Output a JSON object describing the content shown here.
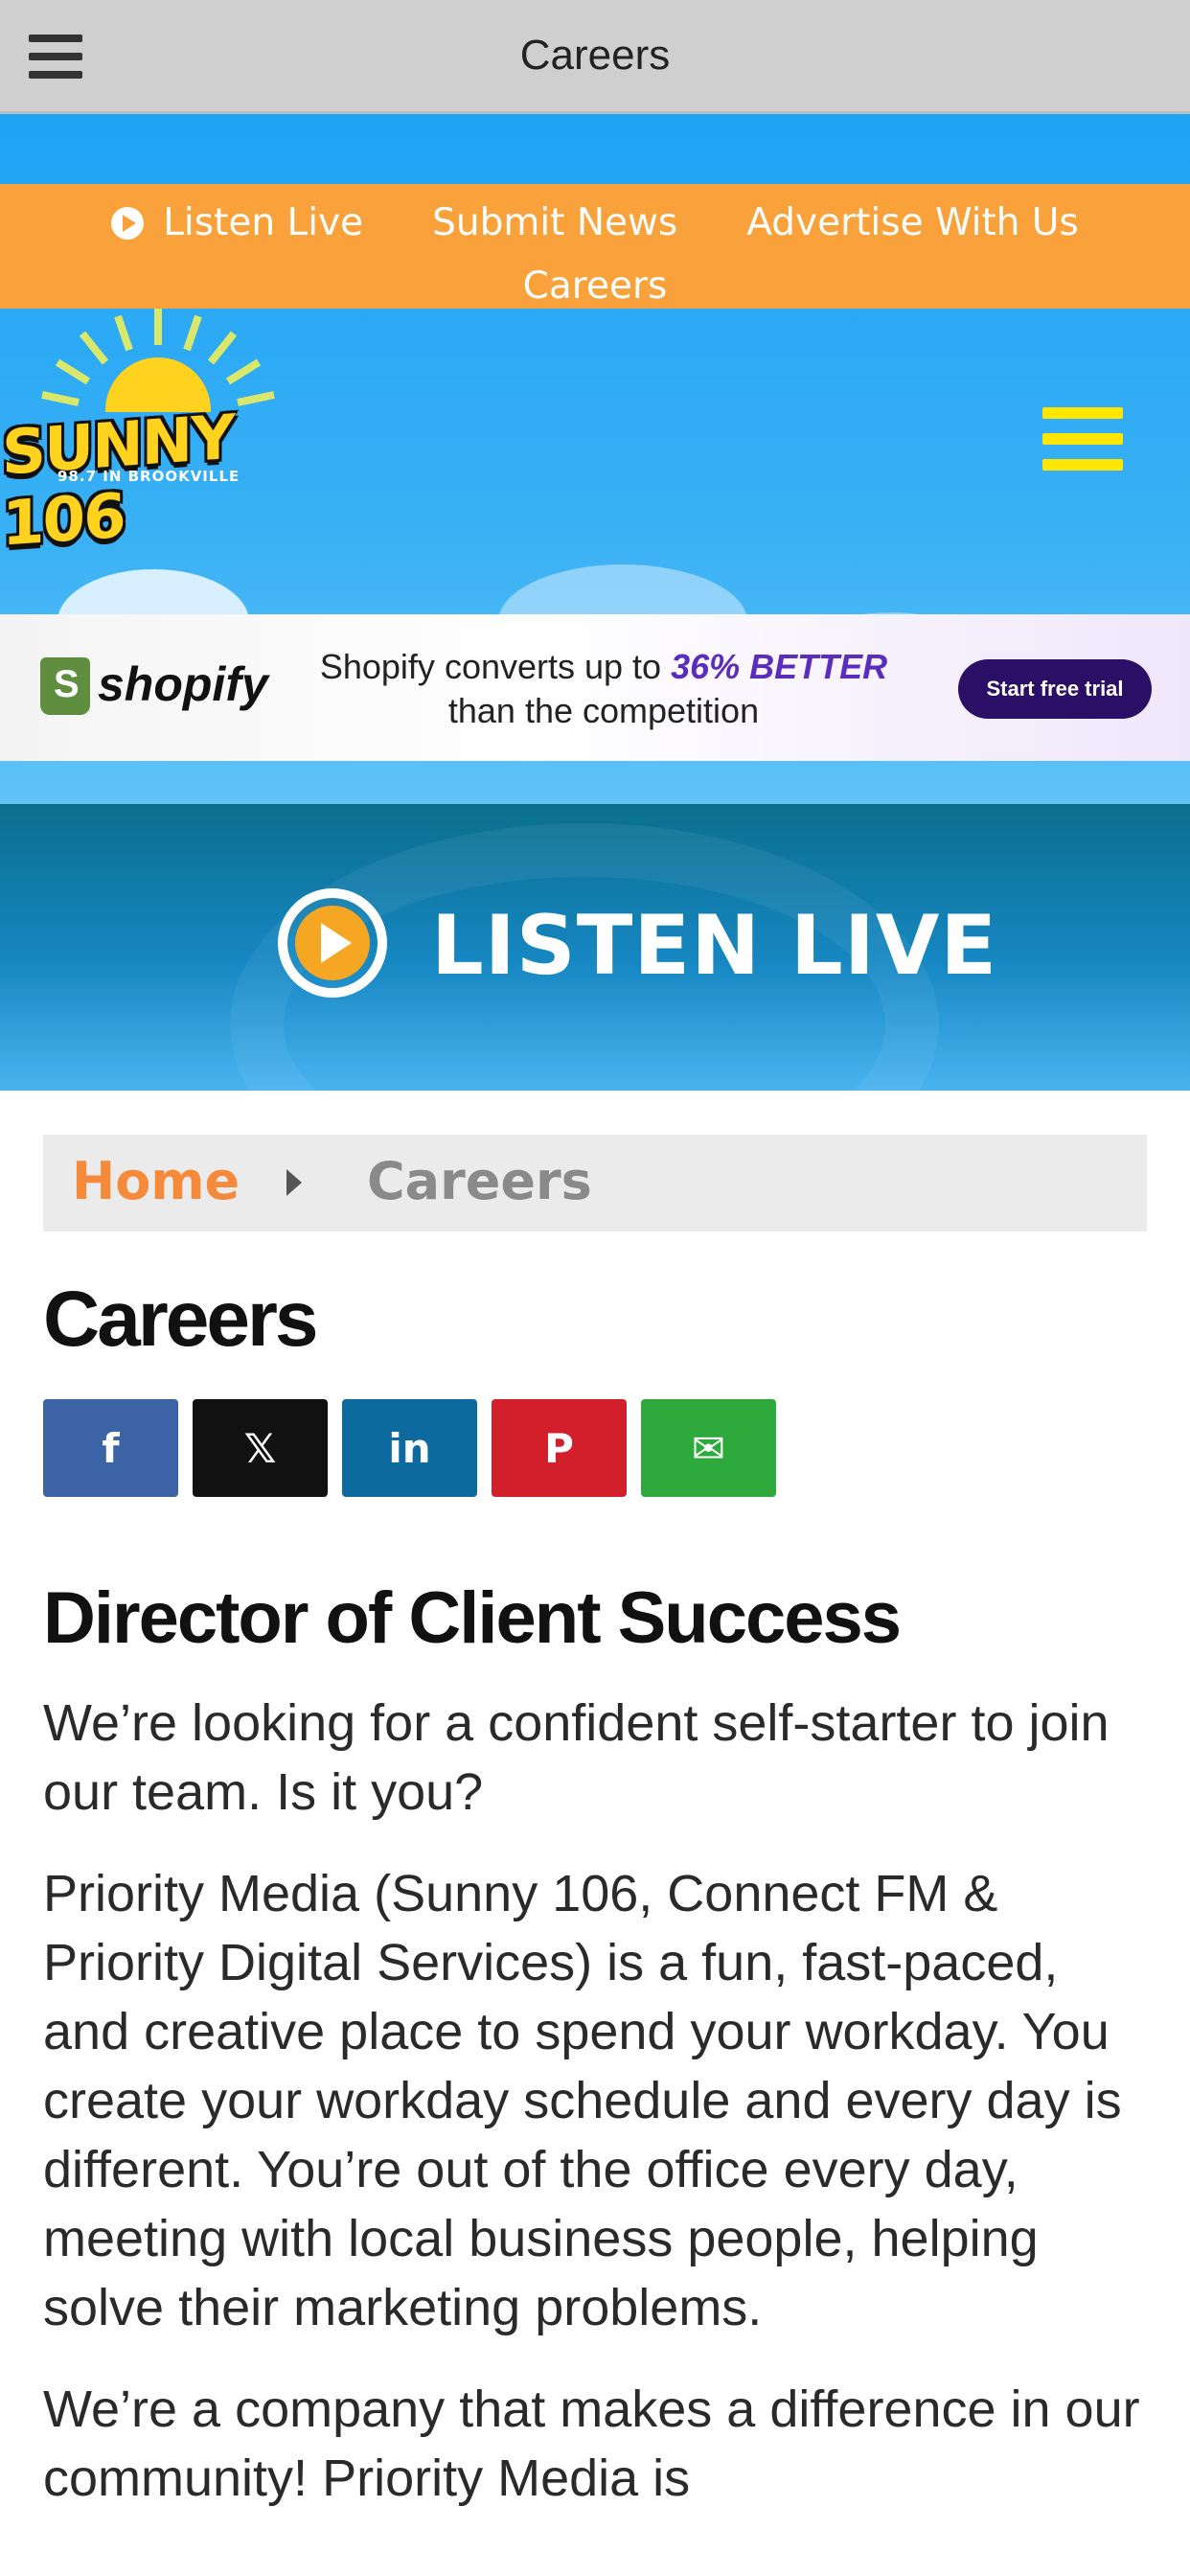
{
  "appbar": {
    "title": "Careers"
  },
  "topnav": {
    "items": [
      "Listen Live",
      "Submit News",
      "Advertise With Us",
      "Careers"
    ]
  },
  "logo": {
    "name": "SUNNY 106",
    "tagline": "98.7 IN BROOKVILLE"
  },
  "ad": {
    "brand": "shopify",
    "line1_prefix": "Shopify converts up to ",
    "line1_emphasis": "36% BETTER",
    "line2": "than the competition",
    "cta": "Start free trial"
  },
  "listen_banner": {
    "label": "LISTEN LIVE"
  },
  "breadcrumb": {
    "home": "Home",
    "current": "Careers"
  },
  "page": {
    "title": "Careers",
    "job_title": "Director of Client Success",
    "paragraphs": [
      "We’re looking for a confident self-starter to join our team.  Is it you?",
      "Priority Media (Sunny 106, Connect FM & Priority Digital Services) is a fun, fast-paced, and creative place to spend your workday.  You create your workday schedule and every day is different.  You’re out of the office every day, meeting with local business people, helping solve their marketing problems.",
      "We’re a company that makes a difference in our community!  Priority Media is"
    ]
  },
  "share": [
    {
      "name": "facebook-icon",
      "glyph": "f"
    },
    {
      "name": "x-icon",
      "glyph": "𝕏"
    },
    {
      "name": "linkedin-icon",
      "glyph": "in"
    },
    {
      "name": "pinterest-icon",
      "glyph": "P"
    },
    {
      "name": "email-icon",
      "glyph": "✉"
    }
  ],
  "colors": {
    "nav_orange": "#f9a13a",
    "sky_blue": "#1ea3f5",
    "home_orange": "#f58a3a",
    "facebook": "#3c63a6",
    "x": "#111111",
    "linkedin": "#0d6a9e",
    "pinterest": "#d21f2b",
    "email": "#2eaa3d"
  }
}
